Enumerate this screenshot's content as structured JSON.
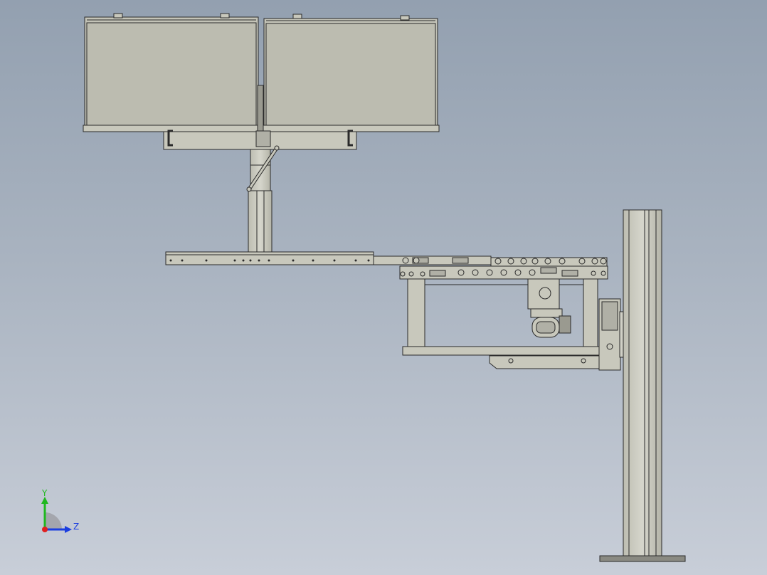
{
  "view": {
    "background_top": "#93a0b0",
    "background_bottom": "#c8ced8",
    "part_fill": "#c8c8bc",
    "panel_fill": "#bdbdb1",
    "edge_color": "#2a2a2a"
  },
  "triad": {
    "y_label": "Y",
    "z_label": "Z",
    "y_color": "#1fb81f",
    "z_color": "#1b3ee0",
    "x_color": "#e02020"
  }
}
